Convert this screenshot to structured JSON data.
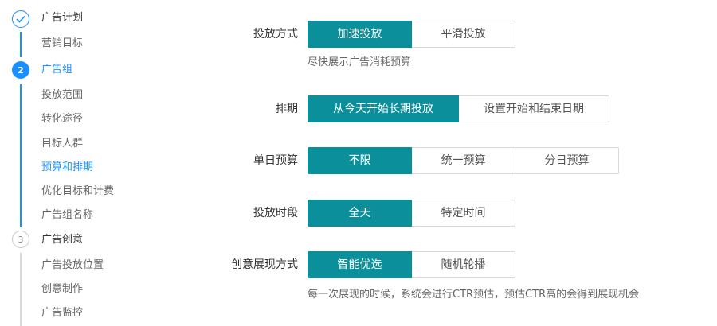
{
  "steps": {
    "step1": {
      "title": "广告计划",
      "items": [
        "营销目标"
      ]
    },
    "step2": {
      "number": "2",
      "title": "广告组",
      "items": [
        "投放范围",
        "转化途径",
        "目标人群",
        "预算和排期",
        "优化目标和计费",
        "广告组名称"
      ]
    },
    "step3": {
      "number": "3",
      "title": "广告创意",
      "items": [
        "广告投放位置",
        "创意制作",
        "广告监控"
      ]
    }
  },
  "form": {
    "delivery": {
      "label": "投放方式",
      "options": [
        "加速投放",
        "平滑投放"
      ],
      "selected": "加速投放",
      "hint": "尽快展示广告消耗预算"
    },
    "schedule": {
      "label": "排期",
      "options": [
        "从今天开始长期投放",
        "设置开始和结束日期"
      ],
      "selected": "从今天开始长期投放"
    },
    "daily_budget": {
      "label": "单日预算",
      "options": [
        "不限",
        "统一预算",
        "分日预算"
      ],
      "selected": "不限"
    },
    "time_slot": {
      "label": "投放时段",
      "options": [
        "全天",
        "特定时间"
      ],
      "selected": "全天"
    },
    "creative_display": {
      "label": "创意展现方式",
      "options": [
        "智能优选",
        "随机轮播"
      ],
      "selected": "智能优选",
      "hint": "每一次展现的时候，系统会进行CTR预估，预估CTR高的会得到展现机会"
    }
  },
  "colors": {
    "accent_blue": "#1890ff",
    "selected_teal": "#0b8f9a",
    "border": "#d9d9d9"
  },
  "icons": {
    "step1_status": "check-icon"
  }
}
